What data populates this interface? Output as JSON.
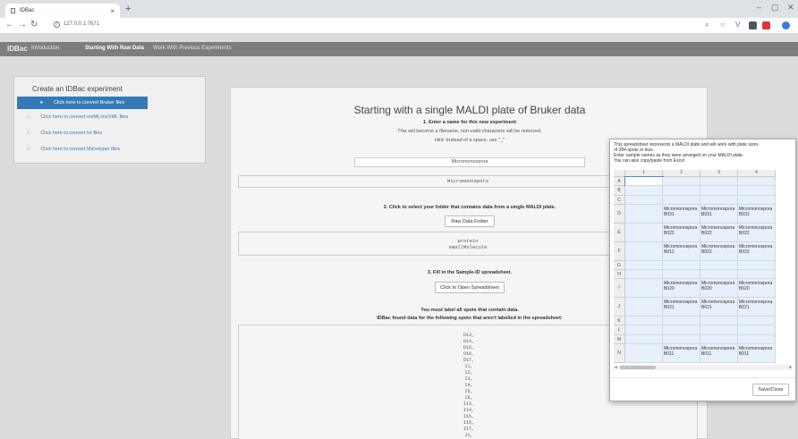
{
  "browser": {
    "tab_title": "IDBac",
    "new_tab": "+",
    "url": "127.0.0.1:7671"
  },
  "navbar": {
    "brand": "IDBac",
    "links": [
      "Introduction",
      "Starting With Raw Data",
      "Work With Previous Experiments"
    ],
    "active_index": 1
  },
  "sidebar": {
    "title": "Create an IDBac experiment",
    "options": [
      "Click here to convert Bruker files",
      "Click here to convert mzML/mzXML files",
      "Click here to convert txt files",
      "Click here to convert Microtyper files"
    ],
    "selected_index": 0
  },
  "main": {
    "title": "Starting with a single MALDI plate of Bruker data",
    "step1": "1. Enter a name for this new experiment",
    "step1_hint1": "This will become a filename, non-valid characters will be removed.",
    "step1_hint2": "Hint: Instead of a space, use \"_\"",
    "experiment_name": "Micromonospora",
    "experiment_name_echo": "Micromonospora",
    "step2": "2. Click to select your folder that contains data from a single MALDI plate.",
    "raw_data_button": "Raw Data Folder",
    "raw_data_path_line1": "protein",
    "raw_data_path_line2": "smallMolecule",
    "step3": "3. Fill in the Sample-ID spreadsheet.",
    "spreadsheet_button": "Click to Open Spreadsheet",
    "warning1": "You must label all spots that contain data.",
    "warning2": "IDBac found data for the following spots that aren't labelled in the spreadsheet:",
    "unlabelled_spots": [
      "D13,",
      "D14,",
      "D15,",
      "D16,",
      "D17,",
      "I1,",
      "I2,",
      "I3,",
      "I4,",
      "I5,",
      "I6,",
      "I13,",
      "I14,",
      "I15,",
      "I16,",
      "I17,",
      "J1,"
    ]
  },
  "modal": {
    "line1": "This spreadsheet represents a MALDI plate and will work with plate sizes",
    "line2": "of 384-spots or less.",
    "line3": "Enter sample names as they were arranged on your MALDI plate.",
    "line4": "You can also copy/paste from Excel",
    "col_headers": [
      "1",
      "2",
      "3",
      "4"
    ],
    "row_headers": [
      "A",
      "B",
      "C",
      "D",
      "E",
      "F",
      "G",
      "H",
      "I",
      "J",
      "K",
      "L",
      "M",
      "N",
      "O",
      "P"
    ],
    "cells": {
      "D": [
        "",
        "Micromonospora B031",
        "Micromonospora B031",
        "Micromonospora B031"
      ],
      "E": [
        "",
        "Micromonospora B022",
        "Micromonospora B022",
        "Micromonospora B022"
      ],
      "F": [
        "",
        "Micromonospora B012",
        "Micromonospora B022",
        "Micromonospora B022"
      ],
      "I": [
        "",
        "Micromonospora B020",
        "Micromonospora B020",
        "Micromonospora B020"
      ],
      "J": [
        "",
        "Micromonospora B021",
        "Micromonospora B021",
        "Micromonospora B021"
      ],
      "N": [
        "",
        "Micromonospora B011",
        "Micromonospora B011",
        "Micromonospora B011"
      ]
    },
    "save_close": "Save/Close"
  },
  "colors": {
    "primary": "#337ab7",
    "navbar": "#7e7e7e",
    "cell_bg": "#e8f0fb"
  }
}
